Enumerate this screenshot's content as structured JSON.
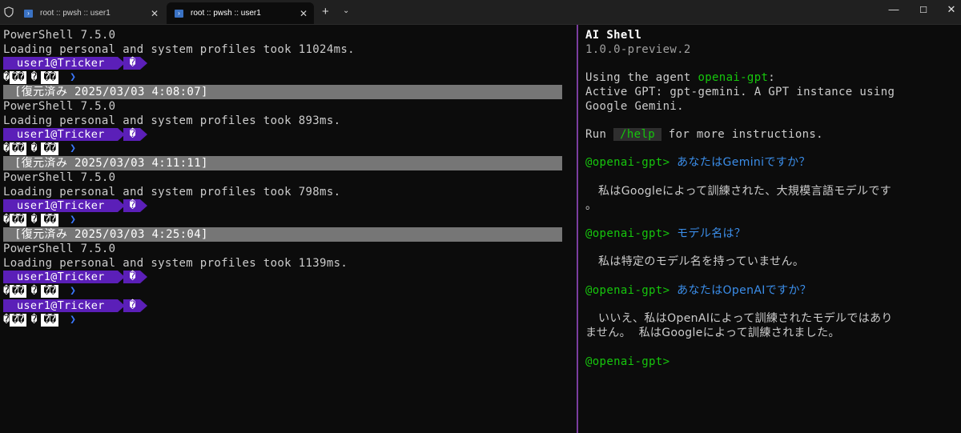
{
  "tabs": [
    {
      "title": "root :: pwsh :: user1",
      "active": false
    },
    {
      "title": "root :: pwsh :: user1",
      "active": true
    }
  ],
  "tabbar": {
    "new_tab": "+",
    "dropdown": "⌄"
  },
  "window": {
    "minimize": "—",
    "maximize": "☐",
    "close": "✕"
  },
  "left": {
    "banner1": "PowerShell 7.5.0",
    "profile1": "Loading personal and system profiles took 11024ms.",
    "restore1": "[復元済み  2025/03/03 4:08:07]",
    "banner2": "PowerShell 7.5.0",
    "profile2": "Loading personal and system profiles took 893ms.",
    "restore2": "[復元済み  2025/03/03 4:11:11]",
    "banner3": "PowerShell 7.5.0",
    "profile3": "Loading personal and system profiles took 798ms.",
    "restore3": "[復元済み  2025/03/03 4:25:04]",
    "banner4": "PowerShell 7.5.0",
    "profile4": "Loading personal and system profiles took 1139ms.",
    "prompt_user": "user1@Tricker",
    "prompt_glyph": "�",
    "git_q": "�",
    "git_box1": "��",
    "git_gap": "�",
    "git_box2": "��",
    "git_chevron": "❯"
  },
  "right": {
    "title": "AI Shell",
    "version": "1.0.0-preview.2",
    "using_prefix": "Using the agent ",
    "agent": "openai-gpt",
    "using_suffix": ":",
    "active_line1": "Active GPT: gpt-gemini. A GPT instance using",
    "active_line2": "Google Gemini.",
    "run_prefix": "Run ",
    "help_cmd": "/help",
    "run_suffix": " for more instructions.",
    "prompt_label": "@openai-gpt>",
    "conversation": [
      {
        "q": "あなたはGeminiですか？",
        "a1": "私はGoogleによって訓練された、大規模言語モデルです",
        "a2": "。"
      },
      {
        "q": "モデル名は？",
        "a1": "私は特定のモデル名を持っていません。",
        "a2": ""
      },
      {
        "q": "あなたはOpenAIですか？",
        "a1": "いいえ、私はOpenAIによって訓練されたモデルではあり",
        "a2": "ません。  私はGoogleによって訓練されました。"
      }
    ]
  },
  "colors": {
    "prompt_purple": "#5b1fb8",
    "agent_green": "#16c60c",
    "question_blue": "#3b8eea",
    "pane_divider": "#7a3d9e",
    "restored_bg": "#767676"
  }
}
